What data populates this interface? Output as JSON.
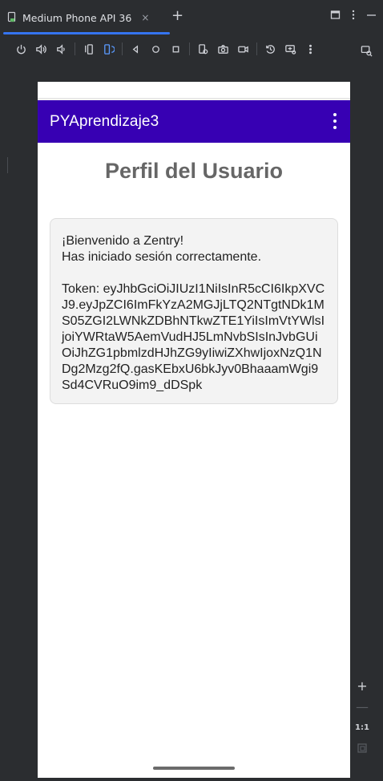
{
  "ide": {
    "tab_label": "Medium Phone API 36",
    "tab_close": "×",
    "new_tab": "+",
    "zoom_in": "+",
    "zoom_out": "—",
    "zoom_ratio": "1:1"
  },
  "app": {
    "toolbar_title": "PYAprendizaje3",
    "page_title": "Perfil del Usuario",
    "message": "¡Bienvenido a Zentry!\nHas iniciado sesión correctamente.\n\nToken: eyJhbGciOiJIUzI1NiIsInR5cCI6IkpXVCJ9.eyJpZCI6ImFkYzA2MGJjLTQ2NTgtNDk1MS05ZGI2LWNkZDBhNTkwZTE1YiIsImVtYWlsIjoiYWRtaW5AemVudHJ5LmNvbSIsInJvbGUiOiJhZG1pbmlzdHJhZG9yIiwiZXhwIjoxNzQ1NDg2Mzg2fQ.gasKEbxU6bkJyv0BhaaamWgi9Sd4CVRuO9im9_dDSpk"
  },
  "colors": {
    "app_bar": "#3700b3",
    "ide_background": "#2b2d30",
    "card_background": "#f3f3f3",
    "title_text": "#666666"
  }
}
